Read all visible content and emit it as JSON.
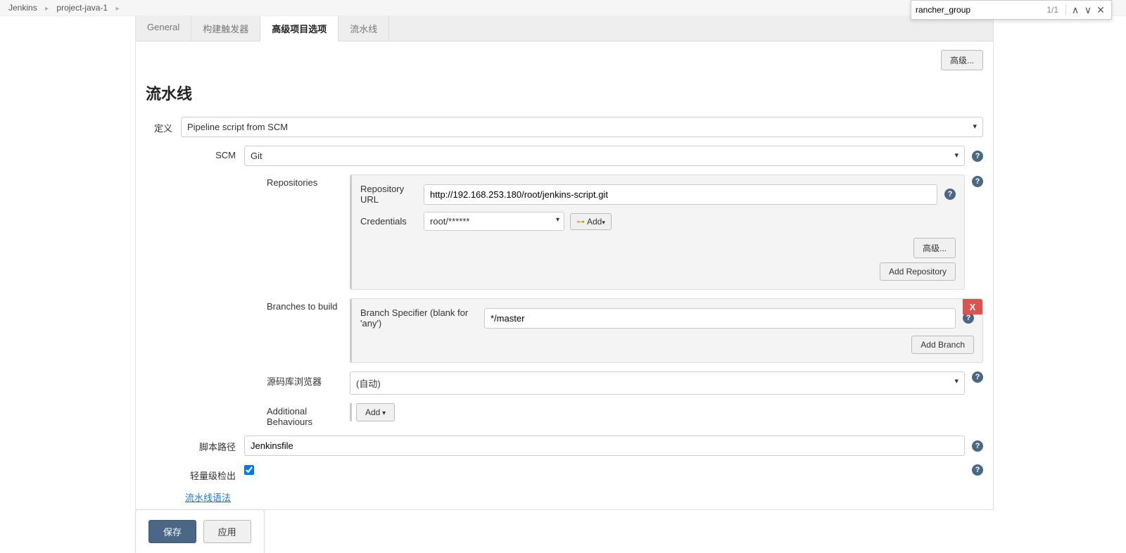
{
  "breadcrumbs": {
    "jenkins": "Jenkins",
    "project": "project-java-1"
  },
  "tabs": {
    "general": "General",
    "triggers": "构建触发器",
    "advanced": "高级项目选项",
    "pipeline": "流水线"
  },
  "buttons": {
    "advanced": "高级...",
    "addRepo": "Add Repository",
    "addBranch": "Add Branch",
    "addCred": "Add",
    "addBehave": "Add",
    "save": "保存",
    "apply": "应用"
  },
  "labels": {
    "sectionTitle": "流水线",
    "definition": "定义",
    "scm": "SCM",
    "repositories": "Repositories",
    "repoUrl": "Repository URL",
    "credentials": "Credentials",
    "branches": "Branches to build",
    "branchSpec": "Branch Specifier (blank for 'any')",
    "repoBrowser": "源码库浏览器",
    "addlBehave": "Additional Behaviours",
    "scriptPath": "脚本路径",
    "lightweight": "轻量级检出",
    "pipelineSyntax": "流水线语法"
  },
  "values": {
    "definitionSelect": "Pipeline script from SCM",
    "scmSelect": "Git",
    "repoUrl": "http://192.168.253.180/root/jenkins-script.git",
    "credentials": "root/******",
    "branchSpec": "*/master",
    "repoBrowser": "(自动)",
    "scriptPath": "Jenkinsfile"
  },
  "findBar": {
    "query": "rancher_group",
    "count": "1/1"
  },
  "closeX": "X"
}
